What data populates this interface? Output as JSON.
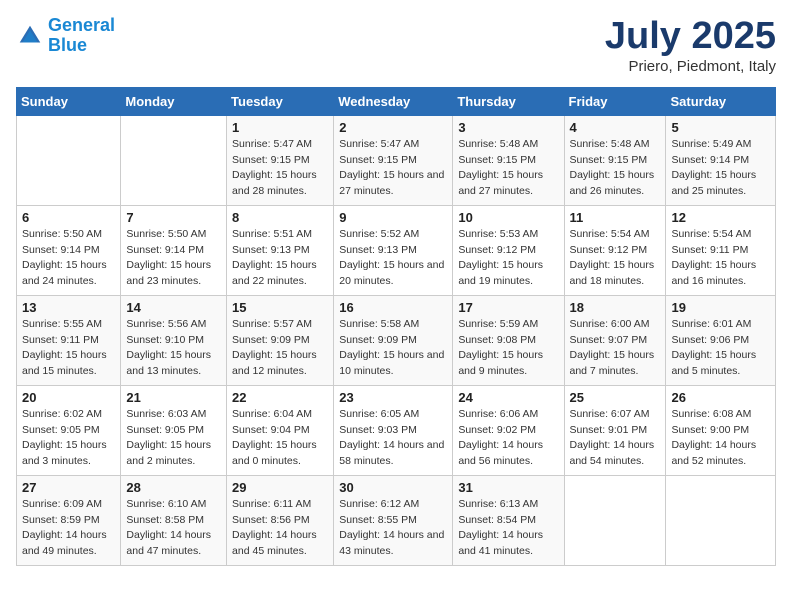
{
  "header": {
    "logo_line1": "General",
    "logo_line2": "Blue",
    "month_title": "July 2025",
    "location": "Priero, Piedmont, Italy"
  },
  "weekdays": [
    "Sunday",
    "Monday",
    "Tuesday",
    "Wednesday",
    "Thursday",
    "Friday",
    "Saturday"
  ],
  "weeks": [
    [
      {
        "day": "",
        "sunrise": "",
        "sunset": "",
        "daylight": ""
      },
      {
        "day": "",
        "sunrise": "",
        "sunset": "",
        "daylight": ""
      },
      {
        "day": "1",
        "sunrise": "Sunrise: 5:47 AM",
        "sunset": "Sunset: 9:15 PM",
        "daylight": "Daylight: 15 hours and 28 minutes."
      },
      {
        "day": "2",
        "sunrise": "Sunrise: 5:47 AM",
        "sunset": "Sunset: 9:15 PM",
        "daylight": "Daylight: 15 hours and 27 minutes."
      },
      {
        "day": "3",
        "sunrise": "Sunrise: 5:48 AM",
        "sunset": "Sunset: 9:15 PM",
        "daylight": "Daylight: 15 hours and 27 minutes."
      },
      {
        "day": "4",
        "sunrise": "Sunrise: 5:48 AM",
        "sunset": "Sunset: 9:15 PM",
        "daylight": "Daylight: 15 hours and 26 minutes."
      },
      {
        "day": "5",
        "sunrise": "Sunrise: 5:49 AM",
        "sunset": "Sunset: 9:14 PM",
        "daylight": "Daylight: 15 hours and 25 minutes."
      }
    ],
    [
      {
        "day": "6",
        "sunrise": "Sunrise: 5:50 AM",
        "sunset": "Sunset: 9:14 PM",
        "daylight": "Daylight: 15 hours and 24 minutes."
      },
      {
        "day": "7",
        "sunrise": "Sunrise: 5:50 AM",
        "sunset": "Sunset: 9:14 PM",
        "daylight": "Daylight: 15 hours and 23 minutes."
      },
      {
        "day": "8",
        "sunrise": "Sunrise: 5:51 AM",
        "sunset": "Sunset: 9:13 PM",
        "daylight": "Daylight: 15 hours and 22 minutes."
      },
      {
        "day": "9",
        "sunrise": "Sunrise: 5:52 AM",
        "sunset": "Sunset: 9:13 PM",
        "daylight": "Daylight: 15 hours and 20 minutes."
      },
      {
        "day": "10",
        "sunrise": "Sunrise: 5:53 AM",
        "sunset": "Sunset: 9:12 PM",
        "daylight": "Daylight: 15 hours and 19 minutes."
      },
      {
        "day": "11",
        "sunrise": "Sunrise: 5:54 AM",
        "sunset": "Sunset: 9:12 PM",
        "daylight": "Daylight: 15 hours and 18 minutes."
      },
      {
        "day": "12",
        "sunrise": "Sunrise: 5:54 AM",
        "sunset": "Sunset: 9:11 PM",
        "daylight": "Daylight: 15 hours and 16 minutes."
      }
    ],
    [
      {
        "day": "13",
        "sunrise": "Sunrise: 5:55 AM",
        "sunset": "Sunset: 9:11 PM",
        "daylight": "Daylight: 15 hours and 15 minutes."
      },
      {
        "day": "14",
        "sunrise": "Sunrise: 5:56 AM",
        "sunset": "Sunset: 9:10 PM",
        "daylight": "Daylight: 15 hours and 13 minutes."
      },
      {
        "day": "15",
        "sunrise": "Sunrise: 5:57 AM",
        "sunset": "Sunset: 9:09 PM",
        "daylight": "Daylight: 15 hours and 12 minutes."
      },
      {
        "day": "16",
        "sunrise": "Sunrise: 5:58 AM",
        "sunset": "Sunset: 9:09 PM",
        "daylight": "Daylight: 15 hours and 10 minutes."
      },
      {
        "day": "17",
        "sunrise": "Sunrise: 5:59 AM",
        "sunset": "Sunset: 9:08 PM",
        "daylight": "Daylight: 15 hours and 9 minutes."
      },
      {
        "day": "18",
        "sunrise": "Sunrise: 6:00 AM",
        "sunset": "Sunset: 9:07 PM",
        "daylight": "Daylight: 15 hours and 7 minutes."
      },
      {
        "day": "19",
        "sunrise": "Sunrise: 6:01 AM",
        "sunset": "Sunset: 9:06 PM",
        "daylight": "Daylight: 15 hours and 5 minutes."
      }
    ],
    [
      {
        "day": "20",
        "sunrise": "Sunrise: 6:02 AM",
        "sunset": "Sunset: 9:05 PM",
        "daylight": "Daylight: 15 hours and 3 minutes."
      },
      {
        "day": "21",
        "sunrise": "Sunrise: 6:03 AM",
        "sunset": "Sunset: 9:05 PM",
        "daylight": "Daylight: 15 hours and 2 minutes."
      },
      {
        "day": "22",
        "sunrise": "Sunrise: 6:04 AM",
        "sunset": "Sunset: 9:04 PM",
        "daylight": "Daylight: 15 hours and 0 minutes."
      },
      {
        "day": "23",
        "sunrise": "Sunrise: 6:05 AM",
        "sunset": "Sunset: 9:03 PM",
        "daylight": "Daylight: 14 hours and 58 minutes."
      },
      {
        "day": "24",
        "sunrise": "Sunrise: 6:06 AM",
        "sunset": "Sunset: 9:02 PM",
        "daylight": "Daylight: 14 hours and 56 minutes."
      },
      {
        "day": "25",
        "sunrise": "Sunrise: 6:07 AM",
        "sunset": "Sunset: 9:01 PM",
        "daylight": "Daylight: 14 hours and 54 minutes."
      },
      {
        "day": "26",
        "sunrise": "Sunrise: 6:08 AM",
        "sunset": "Sunset: 9:00 PM",
        "daylight": "Daylight: 14 hours and 52 minutes."
      }
    ],
    [
      {
        "day": "27",
        "sunrise": "Sunrise: 6:09 AM",
        "sunset": "Sunset: 8:59 PM",
        "daylight": "Daylight: 14 hours and 49 minutes."
      },
      {
        "day": "28",
        "sunrise": "Sunrise: 6:10 AM",
        "sunset": "Sunset: 8:58 PM",
        "daylight": "Daylight: 14 hours and 47 minutes."
      },
      {
        "day": "29",
        "sunrise": "Sunrise: 6:11 AM",
        "sunset": "Sunset: 8:56 PM",
        "daylight": "Daylight: 14 hours and 45 minutes."
      },
      {
        "day": "30",
        "sunrise": "Sunrise: 6:12 AM",
        "sunset": "Sunset: 8:55 PM",
        "daylight": "Daylight: 14 hours and 43 minutes."
      },
      {
        "day": "31",
        "sunrise": "Sunrise: 6:13 AM",
        "sunset": "Sunset: 8:54 PM",
        "daylight": "Daylight: 14 hours and 41 minutes."
      },
      {
        "day": "",
        "sunrise": "",
        "sunset": "",
        "daylight": ""
      },
      {
        "day": "",
        "sunrise": "",
        "sunset": "",
        "daylight": ""
      }
    ]
  ]
}
